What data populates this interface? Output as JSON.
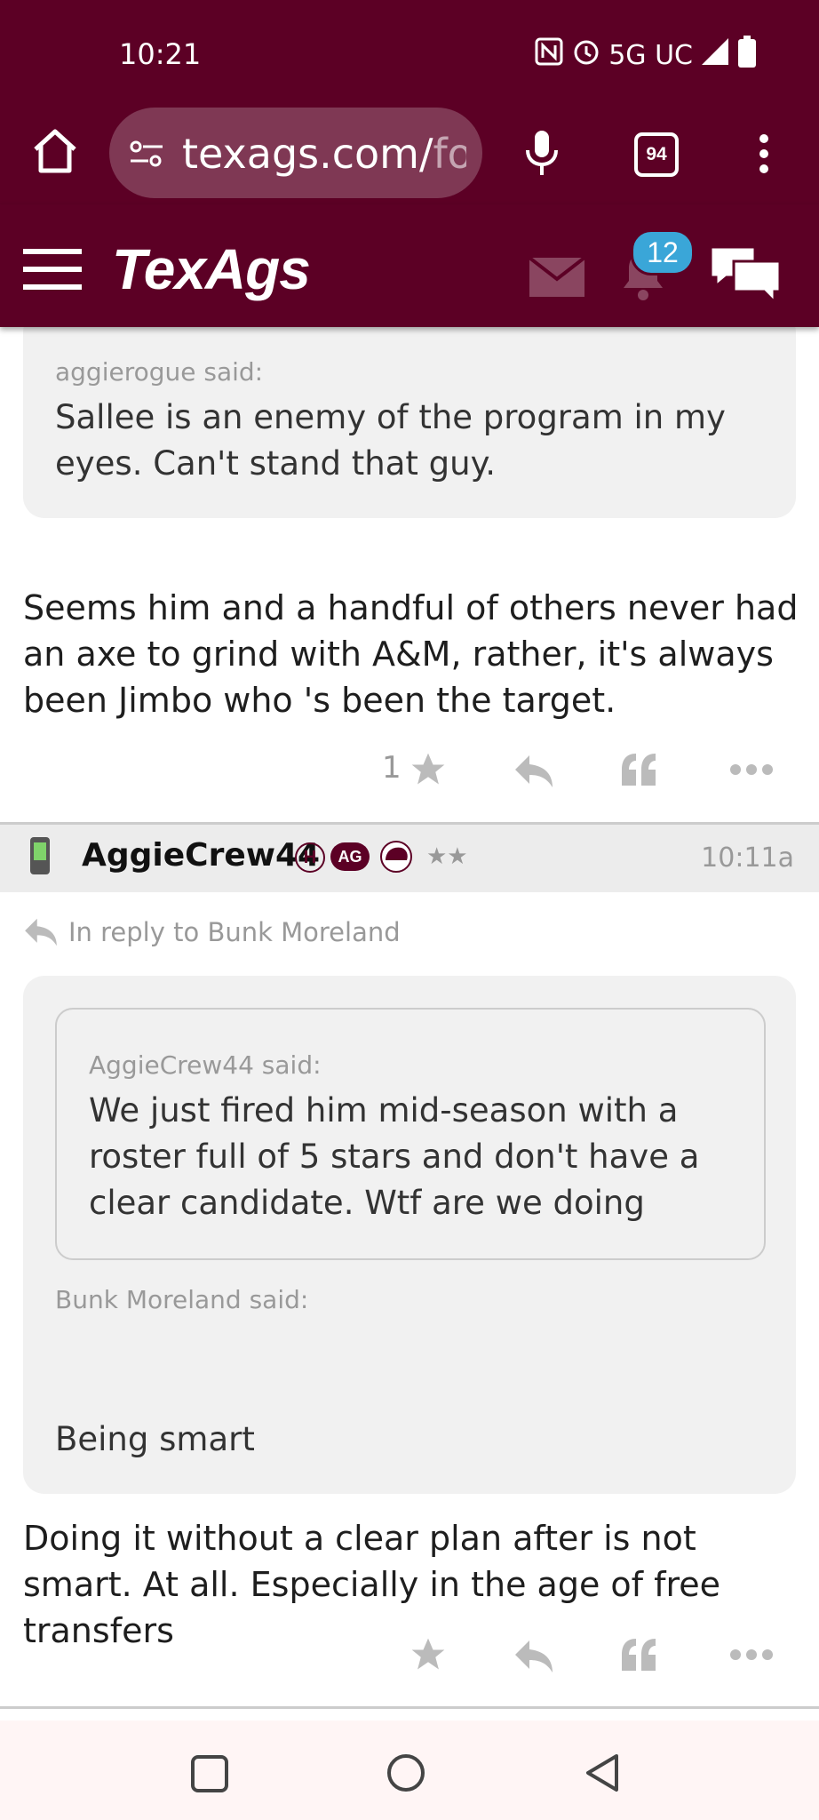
{
  "status_bar": {
    "time": "10:21",
    "network": "5G UC"
  },
  "browser": {
    "url_visible": "texags.com/",
    "url_faded": "for",
    "tab_count": "94"
  },
  "site": {
    "logo": "TexAgs",
    "notification_count": "12"
  },
  "post1": {
    "quote_author": "aggierogue said:",
    "quote_text": "Sallee is an enemy of the program in my eyes. Can't stand that guy.",
    "body": "Seems him and a handful of others never had an axe to grind with A&M, rather, it's always been Jimbo who 's been the target.",
    "star_count": "1"
  },
  "post2": {
    "username": "AggieCrew44",
    "badges": {
      "h": "H",
      "ag": "AG",
      "stars": "★★"
    },
    "time": "10:11a",
    "reply_to": "In reply to Bunk Moreland",
    "inner_quote_author": "AggieCrew44 said:",
    "inner_quote_text": "We just fired him mid-season with a roster full of 5 stars and don't have a clear candidate. Wtf are we doing",
    "outer_quote_author": "Bunk Moreland said:",
    "outer_quote_text": "Being smart",
    "body": "Doing it without a clear plan after is not smart. At all. Especially in the age of free transfers"
  }
}
